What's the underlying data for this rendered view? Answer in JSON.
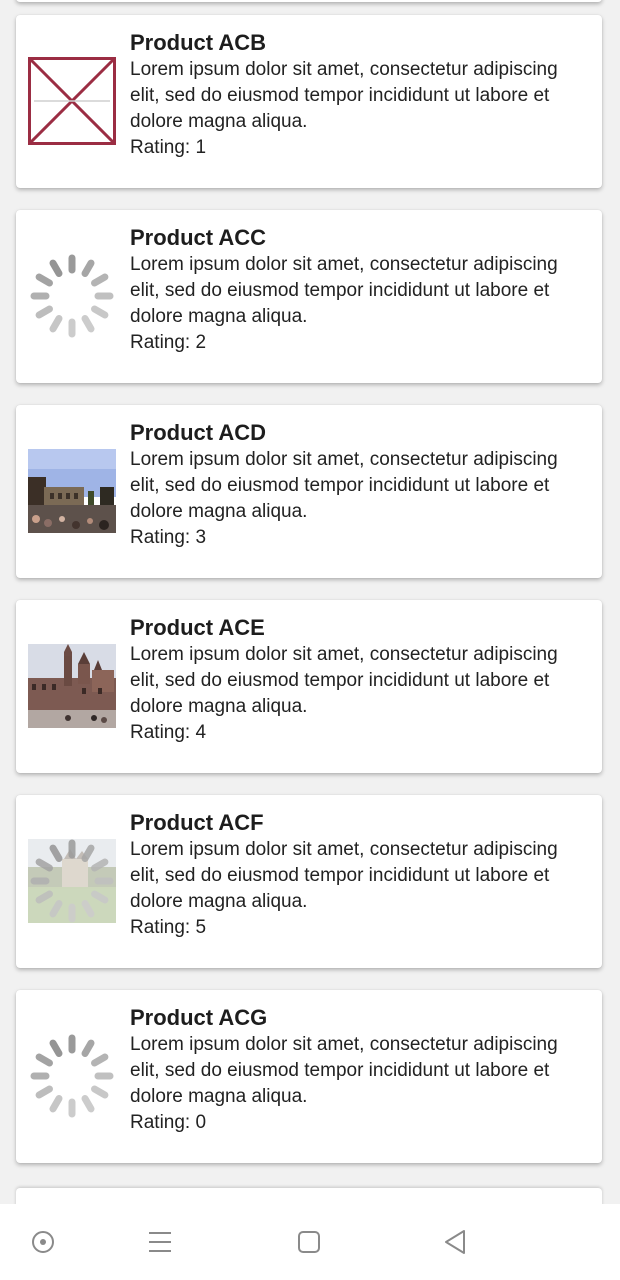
{
  "products": [
    {
      "title": "Product ACB",
      "description": "Lorem ipsum dolor sit amet, consectetur adipiscing elit, sed do eiusmod tempor incididunt ut labore et dolore magna aliqua.",
      "rating": "Rating: 1",
      "thumbnail": "broken-image-icon"
    },
    {
      "title": "Product ACC",
      "description": "Lorem ipsum dolor sit amet, consectetur adipiscing elit, sed do eiusmod tempor incididunt ut labore et dolore magna aliqua.",
      "rating": "Rating: 2",
      "thumbnail": "loading-spinner-icon"
    },
    {
      "title": "Product ACD",
      "description": "Lorem ipsum dolor sit amet, consectetur adipiscing elit, sed do eiusmod tempor incididunt ut labore et dolore magna aliqua.",
      "rating": "Rating: 3",
      "thumbnail": "colosseum-photo"
    },
    {
      "title": "Product ACE",
      "description": "Lorem ipsum dolor sit amet, consectetur adipiscing elit, sed do eiusmod tempor incididunt ut labore et dolore magna aliqua.",
      "rating": "Rating: 4",
      "thumbnail": "town-hall-photo"
    },
    {
      "title": "Product ACF",
      "description": "Lorem ipsum dolor sit amet, consectetur adipiscing elit, sed do eiusmod tempor incididunt ut labore et dolore magna aliqua.",
      "rating": "Rating: 5",
      "thumbnail": "castle-photo-loading"
    },
    {
      "title": "Product ACG",
      "description": "Lorem ipsum dolor sit amet, consectetur adipiscing elit, sed do eiusmod tempor incididunt ut labore et dolore magna aliqua.",
      "rating": "Rating: 0",
      "thumbnail": "loading-spinner-icon"
    }
  ],
  "navbar": {
    "icons": [
      "assistant-icon",
      "menu-icon",
      "home-square-icon",
      "back-triangle-icon"
    ]
  },
  "colors": {
    "background": "#f1f1f1",
    "card": "#ffffff",
    "broken_image": "#9b2d43",
    "spinner": "#c8c8c8"
  }
}
